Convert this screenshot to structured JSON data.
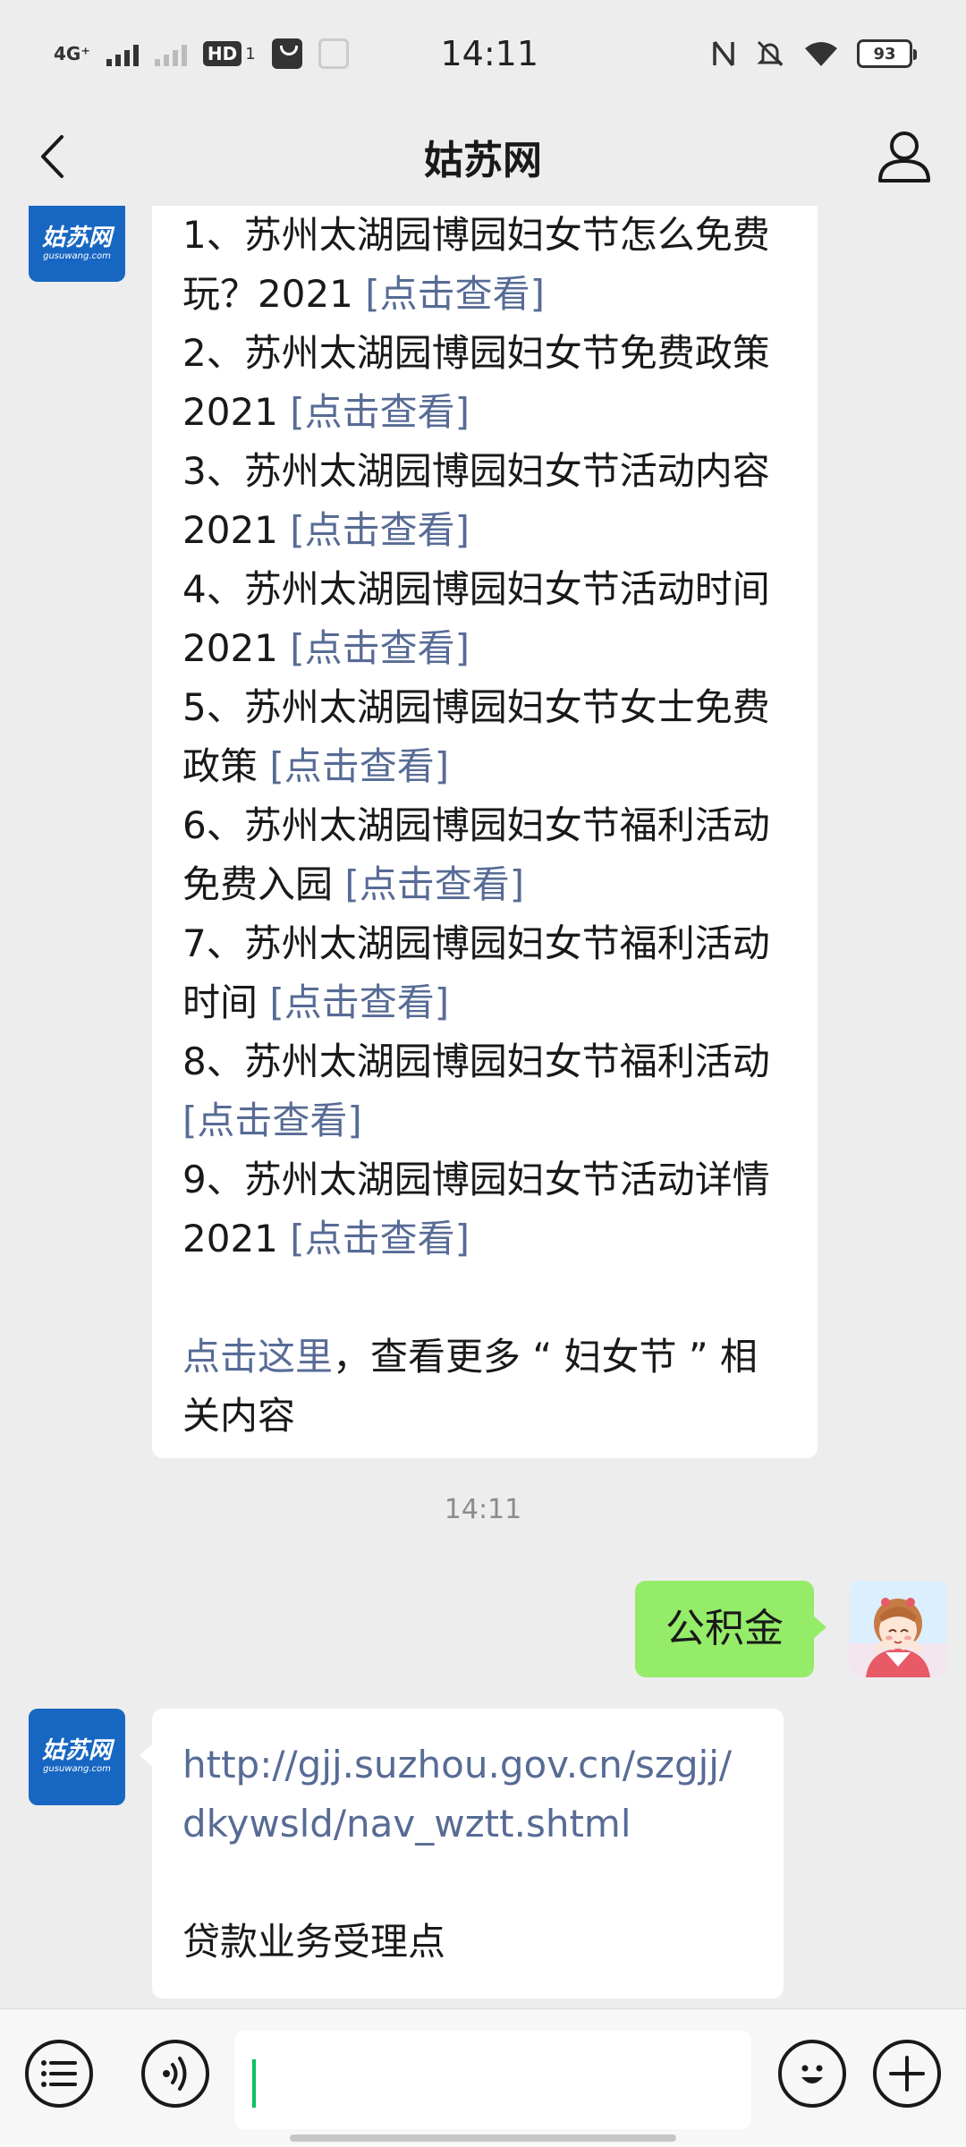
{
  "status_bar": {
    "network": "4G⁺",
    "hd_badge": "HD",
    "hd_sub": "1",
    "time": "14:11",
    "battery": "93"
  },
  "header": {
    "title": "姑苏网"
  },
  "sender_logo": {
    "text_cn": "姑苏网",
    "text_en": "gusuwang.com"
  },
  "message_1": {
    "items": [
      {
        "text": "1、苏州太湖园博园妇女节怎么免费玩？2021 ",
        "link": "[点击查看]"
      },
      {
        "text": "2、苏州太湖园博园妇女节免费政策 2021 ",
        "link": "[点击查看]"
      },
      {
        "text": "3、苏州太湖园博园妇女节活动内容 2021 ",
        "link": "[点击查看]"
      },
      {
        "text": "4、苏州太湖园博园妇女节活动时间 2021 ",
        "link": "[点击查看]"
      },
      {
        "text": "5、苏州太湖园博园妇女节女士免费政策 ",
        "link": "[点击查看]"
      },
      {
        "text": "6、苏州太湖园博园妇女节福利活动免费入园 ",
        "link": "[点击查看]"
      },
      {
        "text": "7、苏州太湖园博园妇女节福利活动时间 ",
        "link": "[点击查看]"
      },
      {
        "text": "8、苏州太湖园博园妇女节福利活动 ",
        "link": "[点击查看]"
      },
      {
        "text": "9、苏州太湖园博园妇女节活动详情 2021 ",
        "link": "[点击查看]"
      }
    ],
    "more_link": "点击这里",
    "more_text": "，查看更多 “ 妇女节 ” 相关内容"
  },
  "timestamp": "14:11",
  "user_message": "公积金",
  "message_2": {
    "url": "http://gjj.suzhou.gov.cn/szgjj/dkywsld/nav_wztt.shtml",
    "caption": "贷款业务受理点"
  },
  "colors": {
    "link": "#576b95",
    "self_bubble": "#95ec69",
    "logo_blue": "#1767c2",
    "caret": "#07c160"
  }
}
